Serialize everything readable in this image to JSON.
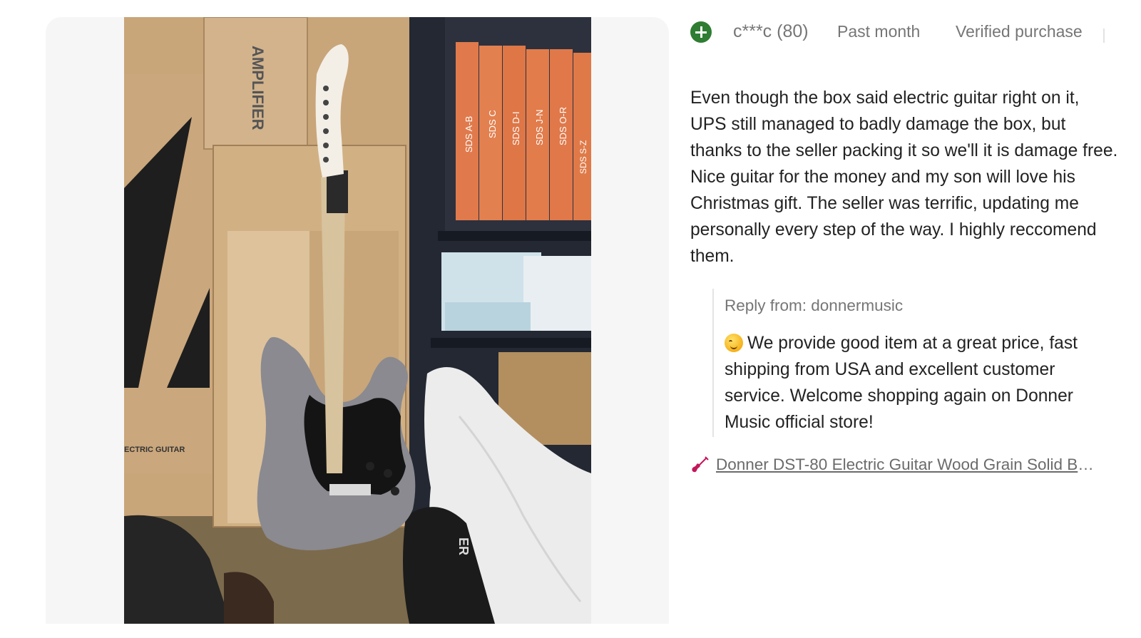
{
  "review": {
    "user": "c***c (80)",
    "date": "Past month",
    "verified": "Verified purchase",
    "text": "Even though the box said electric guitar right on it, UPS still managed to badly damage the box, but thanks to the seller packing it so we'll it is damage free. Nice guitar for the money and my son will love his Christmas gift. The seller was terrific, updating me personally every step of the way. I highly reccomend them."
  },
  "reply": {
    "from": "Reply from: donnermusic",
    "text": "We provide good item at a great price, fast shipping from USA and excellent customer service. Welcome shopping again on Donner Music official store!"
  },
  "product": {
    "link_text": "Donner DST-80 Electric Guitar Wood Grain Solid Bo..."
  },
  "photo": {
    "box_text_top": "AMPLIFIER",
    "box_text_bottom": "ECTRIC GUITAR",
    "binder_labels": [
      "SDS A-B",
      "SDS C",
      "SDS D-I",
      "SDS J-N",
      "SDS O-R",
      "SDS S-Z"
    ],
    "bag_text": "ER"
  },
  "colors": {
    "plus_icon": "#2e7d32",
    "text": "#222222",
    "muted": "#767676"
  },
  "icons": {
    "plus": "plus-circle-icon",
    "guitar": "guitar-icon",
    "emoji": "smiling-face-emoji"
  }
}
